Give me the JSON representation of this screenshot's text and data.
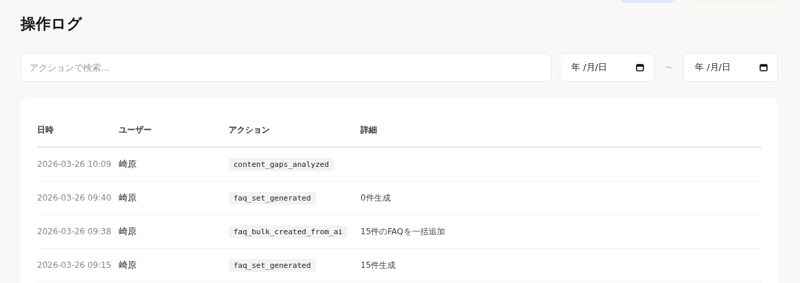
{
  "title": "操作ログ",
  "search": {
    "placeholder": "アクションで検索..."
  },
  "date_from": {
    "value": "年 /月/日"
  },
  "range_separator": "～",
  "date_to": {
    "value": "年 /月/日"
  },
  "table": {
    "columns": [
      "日時",
      "ユーザー",
      "アクション",
      "詳細"
    ],
    "rows": [
      {
        "time": "2026-03-26 10:09",
        "user": "崎原",
        "action": "content_gaps_analyzed"
      },
      {
        "time": "2026-03-26 09:40",
        "user": "崎原",
        "action": "faq_set_generated",
        "detail": "0件生成"
      },
      {
        "time": "2026-03-26 09:38",
        "user": "崎原",
        "action": "faq_bulk_created_from_ai",
        "detail": "15件のFAQを一括追加"
      },
      {
        "time": "2026-03-26 09:15",
        "user": "崎原",
        "action": "faq_set_generated",
        "detail": "15件生成"
      }
    ]
  }
}
